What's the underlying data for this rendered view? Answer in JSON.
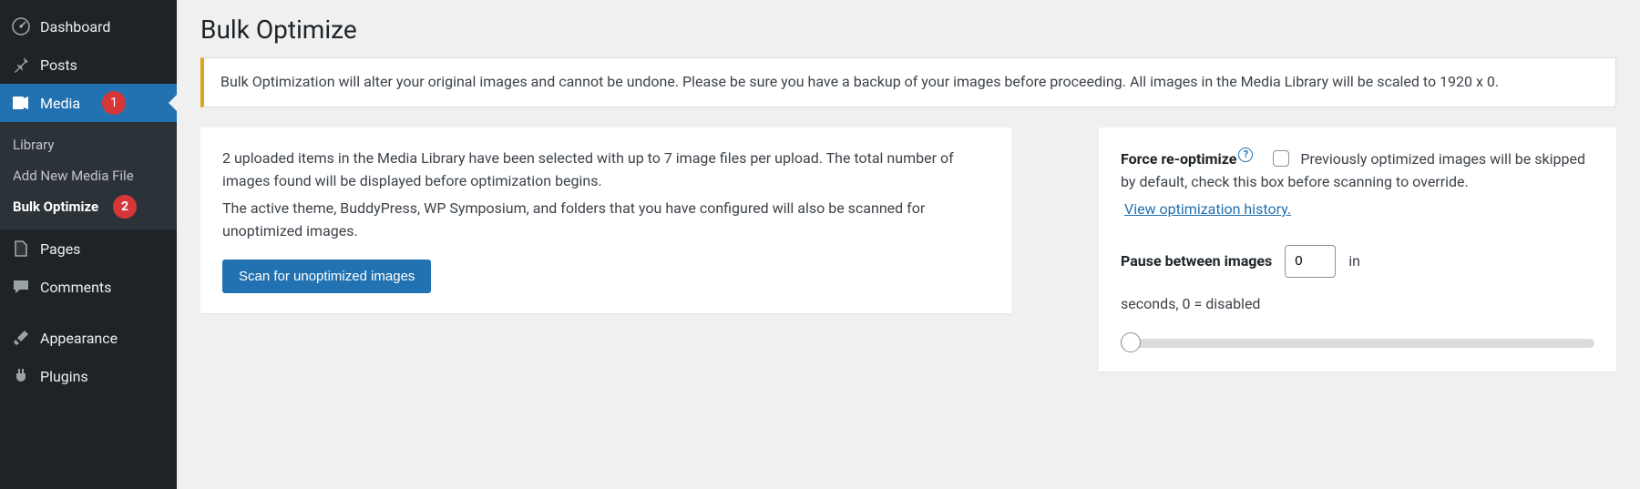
{
  "page_title": "Bulk Optimize",
  "notice_text": "Bulk Optimization will alter your original images and cannot be undone. Please be sure you have a backup of your images before proceeding. All images in the Media Library will be scaled to 1920 x 0.",
  "info_p1": "2 uploaded items in the Media Library have been selected with up to 7 image files per upload. The total number of images found will be displayed before optimization begins.",
  "info_p2": "The active theme, BuddyPress, WP Symposium, and folders that you have configured will also be scanned for unoptimized images.",
  "scan_button": "Scan for unoptimized images",
  "force": {
    "label": "Force re-optimize",
    "desc": "Previously optimized images will be skipped by default, check this box before scanning to override.",
    "history_link": "View optimization history."
  },
  "pause": {
    "label": "Pause between images",
    "value": "0",
    "unit": "in",
    "note": "seconds, 0 = disabled"
  },
  "sidebar": {
    "dashboard": "Dashboard",
    "posts": "Posts",
    "media": "Media",
    "media_badge": "1",
    "pages": "Pages",
    "comments": "Comments",
    "appearance": "Appearance",
    "plugins": "Plugins",
    "sub": {
      "library": "Library",
      "addnew": "Add New Media File",
      "bulk": "Bulk Optimize",
      "bulk_badge": "2"
    }
  }
}
